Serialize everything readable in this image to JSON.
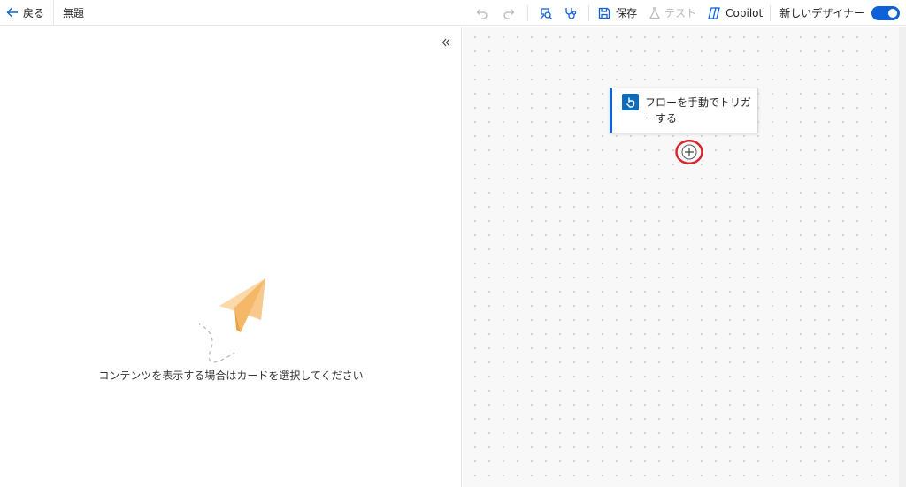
{
  "toolbar": {
    "back_label": "戻る",
    "flow_title": "無題",
    "save_label": "保存",
    "test_label": "テスト",
    "copilot_label": "Copilot",
    "new_designer_label": "新しいデザイナー",
    "new_designer_enabled": true
  },
  "left_panel": {
    "empty_message": "コンテンツを表示する場合はカードを選択してください"
  },
  "canvas": {
    "trigger_card": {
      "label": "フローを手動でトリガーする"
    }
  },
  "icons": {
    "back": "arrow-left-icon",
    "undo": "undo-icon",
    "redo": "redo-icon",
    "flow_checker": "flow-checker-icon",
    "stethoscope": "stethoscope-icon",
    "save": "save-icon",
    "test": "flask-icon",
    "copilot": "copilot-icon",
    "collapse": "double-chevron-left-icon",
    "trigger": "hand-touch-icon",
    "add": "plus-circle-icon",
    "illustration": "paper-plane-icon"
  },
  "colors": {
    "accent": "#1060d8",
    "highlight_ring": "#d9272e",
    "plane": "#f7c98a"
  }
}
